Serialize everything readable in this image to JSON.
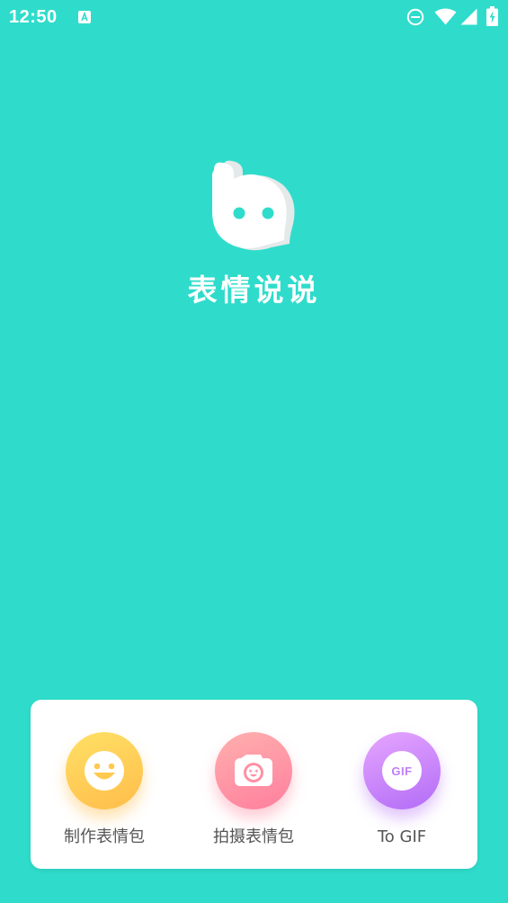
{
  "status_bar": {
    "time": "12:50",
    "icons": [
      "accessibility-icon",
      "do-not-disturb-icon",
      "wifi-icon",
      "signal-icon",
      "battery-charging-icon"
    ]
  },
  "app": {
    "name": "表情说说",
    "mascot_icon": "speech-bubble-mascot-icon"
  },
  "colors": {
    "background": "#2fdccb",
    "card": "#ffffff",
    "mascot_eyes": "#2fdccb",
    "label": "#555555",
    "yellow": "#ffc94f",
    "pink": "#ff8fa3",
    "purple": "#c17ef8"
  },
  "actions": [
    {
      "label": "制作表情包",
      "icon": "smiley-face-icon"
    },
    {
      "label": "拍摄表情包",
      "icon": "camera-icon"
    },
    {
      "label": "To GIF",
      "icon": "gif-icon",
      "icon_text": "GIF"
    }
  ]
}
